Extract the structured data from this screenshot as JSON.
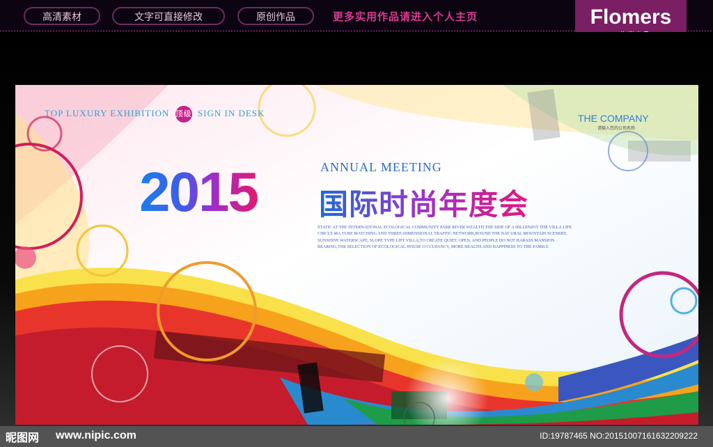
{
  "topbar": {
    "pills": [
      "高清素材",
      "文字可直接修改",
      "原创作品"
    ],
    "promo": "更多实用作品请进入个人主页"
  },
  "brand": {
    "name": "Flomers",
    "subtitle": "工作室出品",
    "color": "#7a1f63"
  },
  "banner": {
    "tagline_a": "TOP LUXURY EXHIBITION",
    "tagline_badge": "顶级",
    "tagline_b": "SIGN IN DESK",
    "company": "THE COMPANY",
    "company_sub": "请输入您的公司名称",
    "year": "2015",
    "annual": "ANNUAL MEETING",
    "title_cn": "国际时尚年度会",
    "paragraph": "STATIC AT THE INTERNATIONAL ECOLOGICAL COMMUNITY PARK RIVER WEALTH THE SIDE OF A HILLENJOY THE VILLA LIFE CIRCLE MA TURE MATCHING AND THREE-DIMENSIONAL TRAFFIC NETWORK,ROUND THE NAT URAL MOUNTAIN SCENERY, SUNSHINE WATERSCAPE, SLOPE TYPE LIFT VILLA,TO CREATE QUIET, OPEN, AND PEOPLE DO NOT HARASS MANSION BEARING,THE SELECTION OF ECOLOGICAL HOUSE O CCUPANCY, MORE HEALTH AND HAPPINESS TO THE FAMILY."
  },
  "footer": {
    "logo": "昵图网",
    "url": "www.nipic.com",
    "image_id": "ID:19787465 NO:20151007161632209222"
  }
}
